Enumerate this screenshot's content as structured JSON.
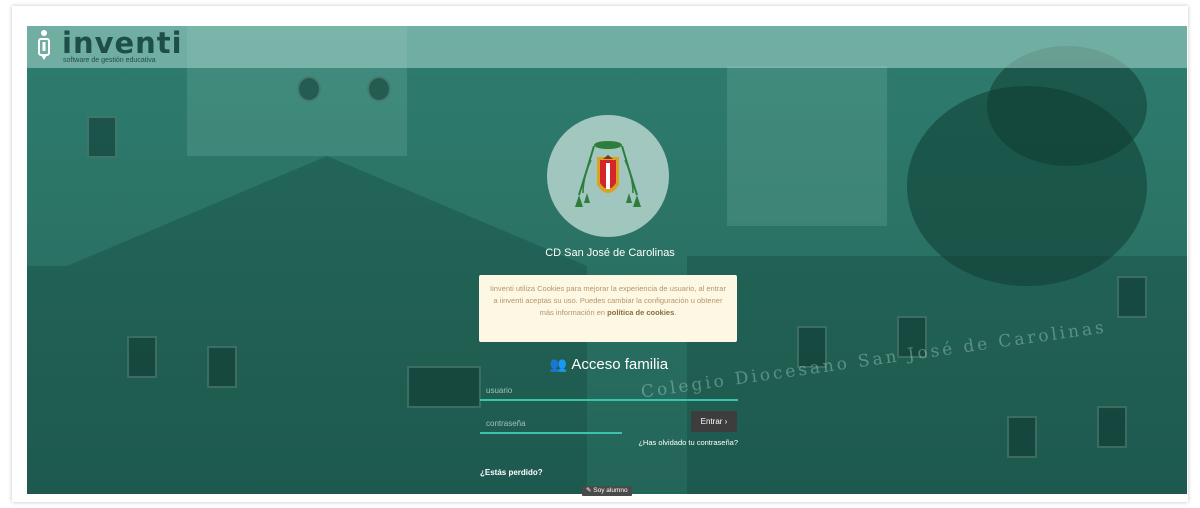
{
  "header": {
    "logo_text": "inventi",
    "tagline": "software de gestión educativa"
  },
  "school": {
    "name": "CD San José de Carolinas"
  },
  "cookies": {
    "text": "Iinventi utiliza Cookies para mejorar la experiencia de usuario, al entrar a iinventi aceptas su uso. Puedes cambiar la configuración u obtener más información en",
    "link_text": "política de cookies",
    "end": "."
  },
  "login": {
    "title": "Acceso familia",
    "title_icon": "users-icon",
    "username_placeholder": "usuario",
    "password_placeholder": "contraseña",
    "submit_label": "Entrar",
    "submit_arrow": "›",
    "forgot_label": "¿Has olvidado tu contraseña?"
  },
  "lost": {
    "question": "¿Estás perdido?",
    "student_button": "Soy alumno"
  },
  "background": {
    "sign_text": "Colegio Diocesano San José de Carolinas"
  },
  "colors": {
    "overlay": "#2b7466",
    "accent_underline": "#3cc3ad",
    "cookie_bg": "#fcf8e3",
    "button_bg": "#3d3d3d"
  }
}
